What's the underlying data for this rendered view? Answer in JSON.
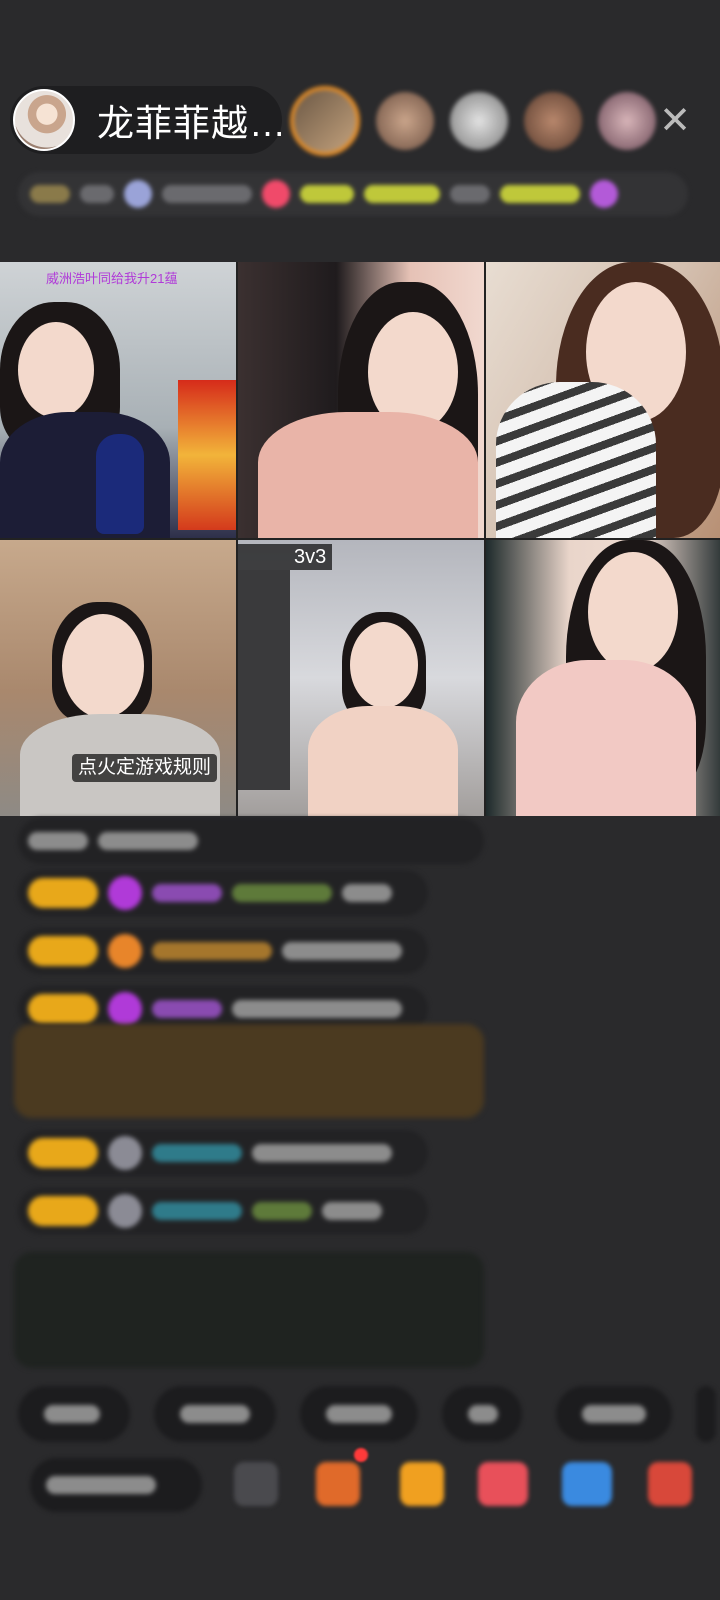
{
  "header": {
    "host_name": "龙菲菲越…",
    "close_symbol": "✕"
  },
  "grid": {
    "tile1_note": "威洲浩叶同给我升21蕴",
    "pk_tag": "3v3",
    "game_rule_label": "点火定游戏规则"
  },
  "colors": {
    "background": "#2a2a2c",
    "badge_gold": "#e8a81a",
    "accent_purple": "#b03ad8",
    "accent_orange": "#e08b28",
    "notification_red": "#ff3a3a"
  },
  "icons": {
    "close": "close-icon",
    "gift": "gift-icon",
    "treasure": "treasure-box-icon",
    "more": "more-icon"
  }
}
